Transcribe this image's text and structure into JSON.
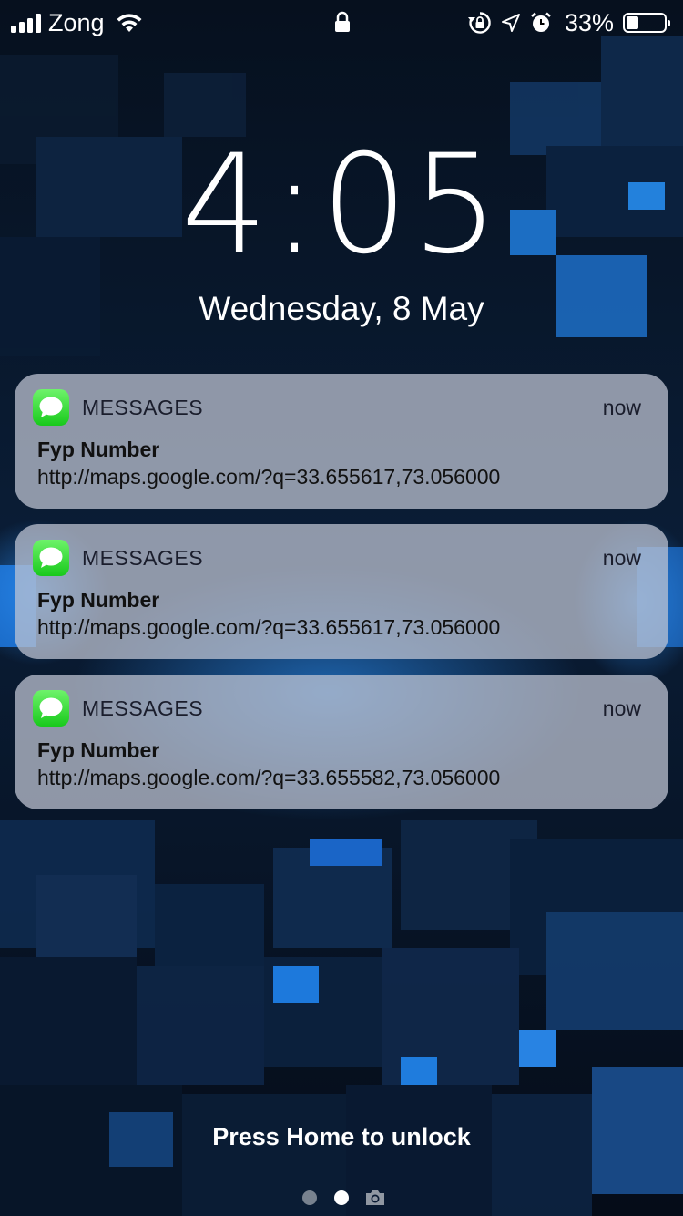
{
  "status_bar": {
    "carrier": "Zong",
    "battery_percent": "33%",
    "battery_level": 0.33,
    "icons": [
      "signal-icon",
      "wifi-icon",
      "lock-icon",
      "rotation-lock-icon",
      "location-icon",
      "alarm-icon",
      "battery-icon"
    ]
  },
  "lock_screen": {
    "time": "4:05",
    "date": "Wednesday, 8 May",
    "unlock_hint": "Press Home to unlock"
  },
  "notifications": [
    {
      "app": "MESSAGES",
      "time": "now",
      "title": "Fyp Number",
      "body": "http://maps.google.com/?q=33.655617,73.056000",
      "icon": "messages-app-icon"
    },
    {
      "app": "MESSAGES",
      "time": "now",
      "title": "Fyp Number",
      "body": "http://maps.google.com/?q=33.655617,73.056000",
      "icon": "messages-app-icon"
    },
    {
      "app": "MESSAGES",
      "time": "now",
      "title": "Fyp Number",
      "body": "http://maps.google.com/?q=33.655582,73.056000",
      "icon": "messages-app-icon"
    }
  ],
  "page_indicator": {
    "pages": 2,
    "current": 2,
    "extra_icon": "camera-icon"
  },
  "colors": {
    "notification_bg": "#bec4d2",
    "messages_green": "#1fd21f",
    "wallpaper_accent": "#1b7fe0"
  }
}
